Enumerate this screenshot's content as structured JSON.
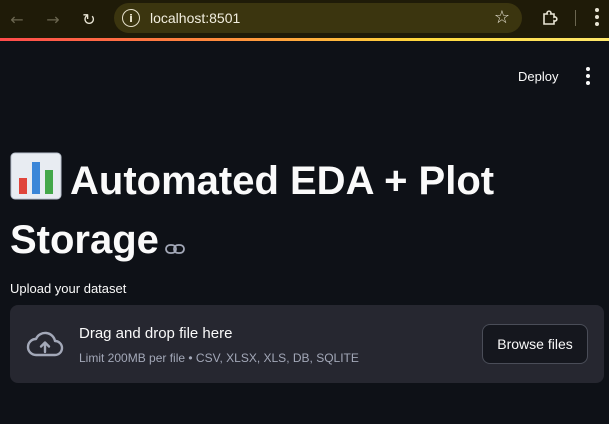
{
  "browser": {
    "url": "localhost:8501",
    "back_icon": "arrow-left-icon",
    "forward_icon": "arrow-right-icon",
    "reload_icon": "reload-icon",
    "bookmark_icon": "star-icon",
    "extensions_icon": "puzzle-icon",
    "accent_gradient": [
      "#ff4b4b",
      "#ffd93d"
    ]
  },
  "header": {
    "deploy_label": "Deploy",
    "menu_icon": "kebab-menu-icon"
  },
  "main": {
    "title": "Automated EDA + Plot Storage",
    "title_icon": "bar-chart-emoji",
    "upload_label": "Upload your dataset",
    "dropzone": {
      "instruction": "Drag and drop file here",
      "limits": "Limit 200MB per file • CSV, XLSX, XLS, DB, SQLITE",
      "browse_label": "Browse files",
      "icon": "cloud-upload-icon"
    }
  },
  "colors": {
    "background": "#0e1117",
    "dropzone_bg": "#262730",
    "text": "#fafafa",
    "muted_text": "#a3a8b8"
  }
}
